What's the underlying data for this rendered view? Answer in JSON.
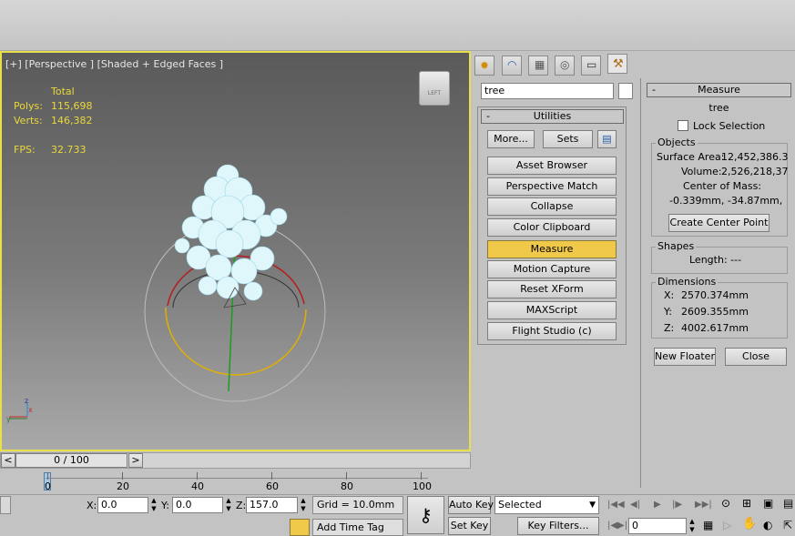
{
  "viewport": {
    "label": "[+] [Perspective ] [Shaded + Edged Faces ]",
    "stats": {
      "header": "Total",
      "polys_label": "Polys:",
      "polys_value": "115,698",
      "verts_label": "Verts:",
      "verts_value": "146,382",
      "fps_label": "FPS:",
      "fps_value": "32.733"
    },
    "viewcube_label": "LEFT",
    "axis": {
      "z": "z",
      "x": "x",
      "y": "y"
    }
  },
  "timeline": {
    "frame_display": "0 / 100",
    "prev": "<",
    "next": ">",
    "ruler_labels": [
      "0",
      "20",
      "40",
      "60",
      "80",
      "100"
    ]
  },
  "command_panel": {
    "name_value": "tree",
    "utilities": {
      "title": "Utilities",
      "more_label": "More...",
      "sets_label": "Sets",
      "items": [
        "Asset Browser",
        "Perspective Match",
        "Collapse",
        "Color Clipboard",
        "Measure",
        "Motion Capture",
        "Reset XForm",
        "MAXScript",
        "Flight Studio (c)"
      ],
      "active": "Measure"
    }
  },
  "measure": {
    "title": "Measure",
    "object_name": "tree",
    "lock_selection_label": "Lock Selection",
    "objects_title": "Objects",
    "surface_area_label": "Surface Area:",
    "surface_area_value": "12,452,386.3",
    "volume_label": "Volume:",
    "volume_value": "2,526,218,37",
    "center_of_mass_label": "Center of Mass:",
    "center_of_mass_value": "-0.339mm, -34.87mm,",
    "create_center_point_label": "Create Center Point",
    "shapes_title": "Shapes",
    "length_label": "Length: ---",
    "dimensions_title": "Dimensions",
    "x_label": "X:",
    "x_value": "2570.374mm",
    "y_label": "Y:",
    "y_value": "2609.355mm",
    "z_label": "Z:",
    "z_value": "4002.617mm",
    "new_floater_label": "New Floater",
    "close_label": "Close"
  },
  "status": {
    "x_label": "X:",
    "x_value": "0.0",
    "y_label": "Y:",
    "y_value": "0.0",
    "z_label": "Z:",
    "z_value": "157.0",
    "grid": "Grid = 10.0mm",
    "add_time_tag": "Add Time Tag",
    "auto_key": "Auto Key",
    "set_key": "Set Key",
    "selected_value": "Selected",
    "key_filters": "Key Filters...",
    "frame_value": "0"
  },
  "colors": {
    "viewport_border": "#e8e04a",
    "stats_text": "#e9d83a",
    "active_button": "#f0c84a"
  }
}
